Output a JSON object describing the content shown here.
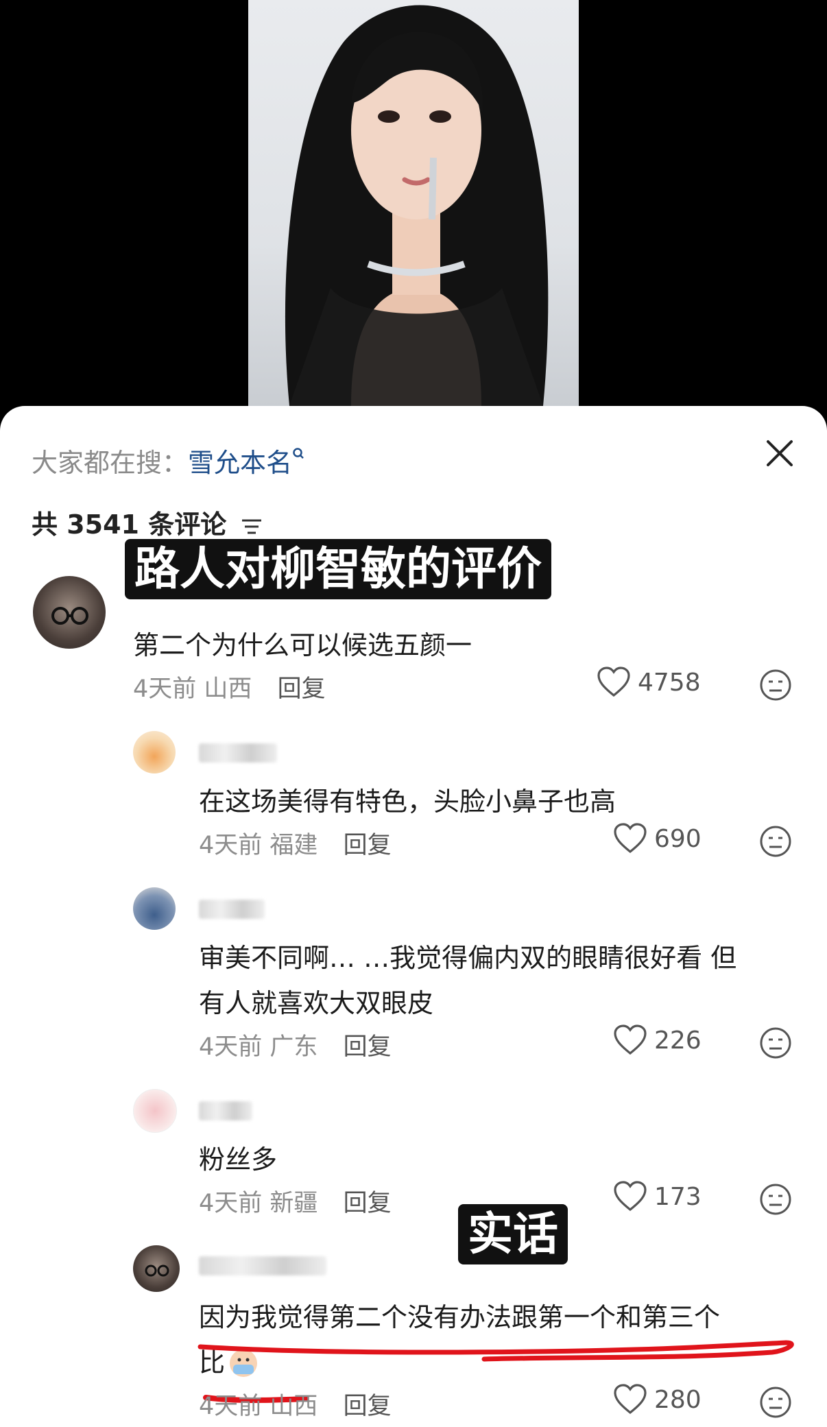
{
  "search": {
    "prefix": "大家都在搜：",
    "term": "雪允本名",
    "icon": "search-icon"
  },
  "comment_count": "共 3541 条评论",
  "overlays": {
    "title": "路人对柳智敏的评价",
    "tag": "实话"
  },
  "comments": [
    {
      "text": "第二个为什么可以候选五颜一",
      "time": "4天前",
      "location": "山西",
      "reply": "回复",
      "likes": "4758"
    },
    {
      "text": "在这场美得有特色，头脸小鼻子也高",
      "time": "4天前",
      "location": "福建",
      "reply": "回复",
      "likes": "690"
    },
    {
      "text_line1": "审美不同啊… …我觉得偏内双的眼睛很好看 但",
      "text_line2": "有人就喜欢大双眼皮",
      "time": "4天前",
      "location": "广东",
      "reply": "回复",
      "likes": "226"
    },
    {
      "text": "粉丝多",
      "time": "4天前",
      "location": "新疆",
      "reply": "回复",
      "likes": "173"
    },
    {
      "text_line1": "因为我觉得第二个没有办法跟第一个和第三个",
      "text_line2": "比",
      "time": "4天前",
      "location": "山西",
      "reply": "回复",
      "likes": "280"
    }
  ],
  "colors": {
    "link": "#1f4e8a",
    "underline": "#e0141b"
  }
}
